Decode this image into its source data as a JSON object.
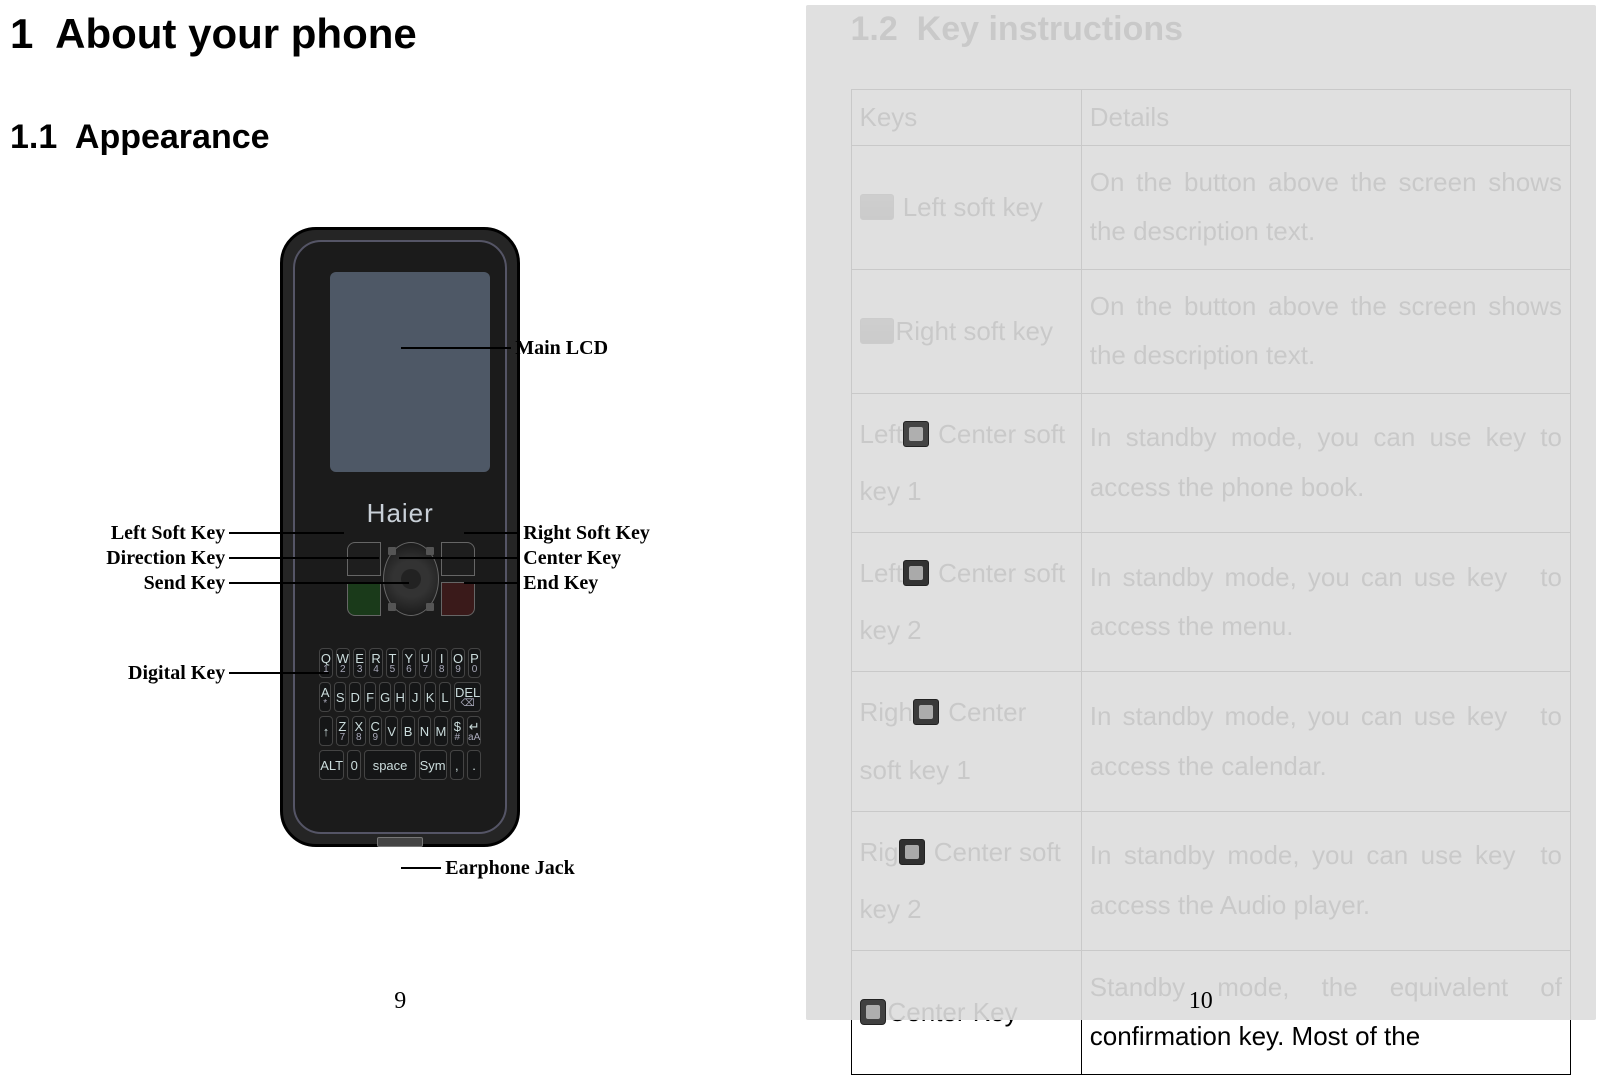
{
  "leftPage": {
    "chapterTitle": "1  About your phone",
    "sectionTitle": "1.1  Appearance",
    "phoneBrand": "Haier",
    "callouts": {
      "mainLCD": "Main LCD",
      "leftSoftKey": "Left Soft Key",
      "rightSoftKey": "Right Soft Key",
      "directionKey": "Direction Key",
      "centerKey": "Center Key",
      "sendKey": "Send Key",
      "endKey": "End Key",
      "digitalKey": "Digital Key",
      "earphoneJack": "Earphone Jack"
    },
    "keypad": {
      "row1": [
        "Q",
        "W",
        "E",
        "R",
        "T",
        "Y",
        "U",
        "I",
        "O",
        "P"
      ],
      "row1sub": [
        "1",
        "2",
        "3",
        "4",
        "5",
        "6",
        "7",
        "8",
        "9",
        "0"
      ],
      "row2": [
        "A",
        "S",
        "D",
        "F",
        "G",
        "H",
        "J",
        "K",
        "L",
        "DEL"
      ],
      "row2sub": [
        "*",
        "",
        "",
        "",
        "",
        "",
        "",
        "",
        "",
        "⌫"
      ],
      "row3": [
        "↑",
        "Z",
        "X",
        "C",
        "V",
        "B",
        "N",
        "M",
        "$",
        "↵"
      ],
      "row3sub": [
        "",
        "7",
        "8",
        "9",
        "",
        "",
        "",
        "",
        "#",
        "aA"
      ],
      "row4": [
        "ALT",
        "0",
        "space",
        "Sym",
        ",",
        "."
      ]
    },
    "pageNumber": "9"
  },
  "rightPage": {
    "sectionTitle": "1.2  Key instructions",
    "tableHeader": {
      "keys": "Keys",
      "details": "Details"
    },
    "rows": [
      {
        "keyPre": "",
        "keyPost": " Left soft key",
        "detail": "On the button above the screen shows the description text.",
        "iconClass": "soft"
      },
      {
        "keyPre": "",
        "keyPost": "Right soft key",
        "detail": "On the button above the screen shows the description text.",
        "iconClass": "soft"
      },
      {
        "keyPre": "Left",
        "keyPost": " Center soft key 1",
        "detail": "In standby mode, you can use key to access the phone book.",
        "iconClass": "square center1"
      },
      {
        "keyPre": "Left",
        "keyPost": " Center soft key 2",
        "detail": "In standby mode, you can use key   to access the menu.",
        "iconClass": "square center2"
      },
      {
        "keyPre": "Righ",
        "keyPost": " Center soft key 1",
        "detail": "In standby mode, you can use key   to access the calendar.",
        "iconClass": "square center3"
      },
      {
        "keyPre": "Rig",
        "keyPost": " Center soft key 2",
        "detail": "In standby mode, you can use key  to access the Audio player.",
        "iconClass": "square center4"
      },
      {
        "keyPre": "",
        "keyPost": "Center Key",
        "detail": "Standby mode, the equivalent of confirmation key. Most of the",
        "iconClass": "square centerK"
      }
    ],
    "pageNumber": "10"
  }
}
